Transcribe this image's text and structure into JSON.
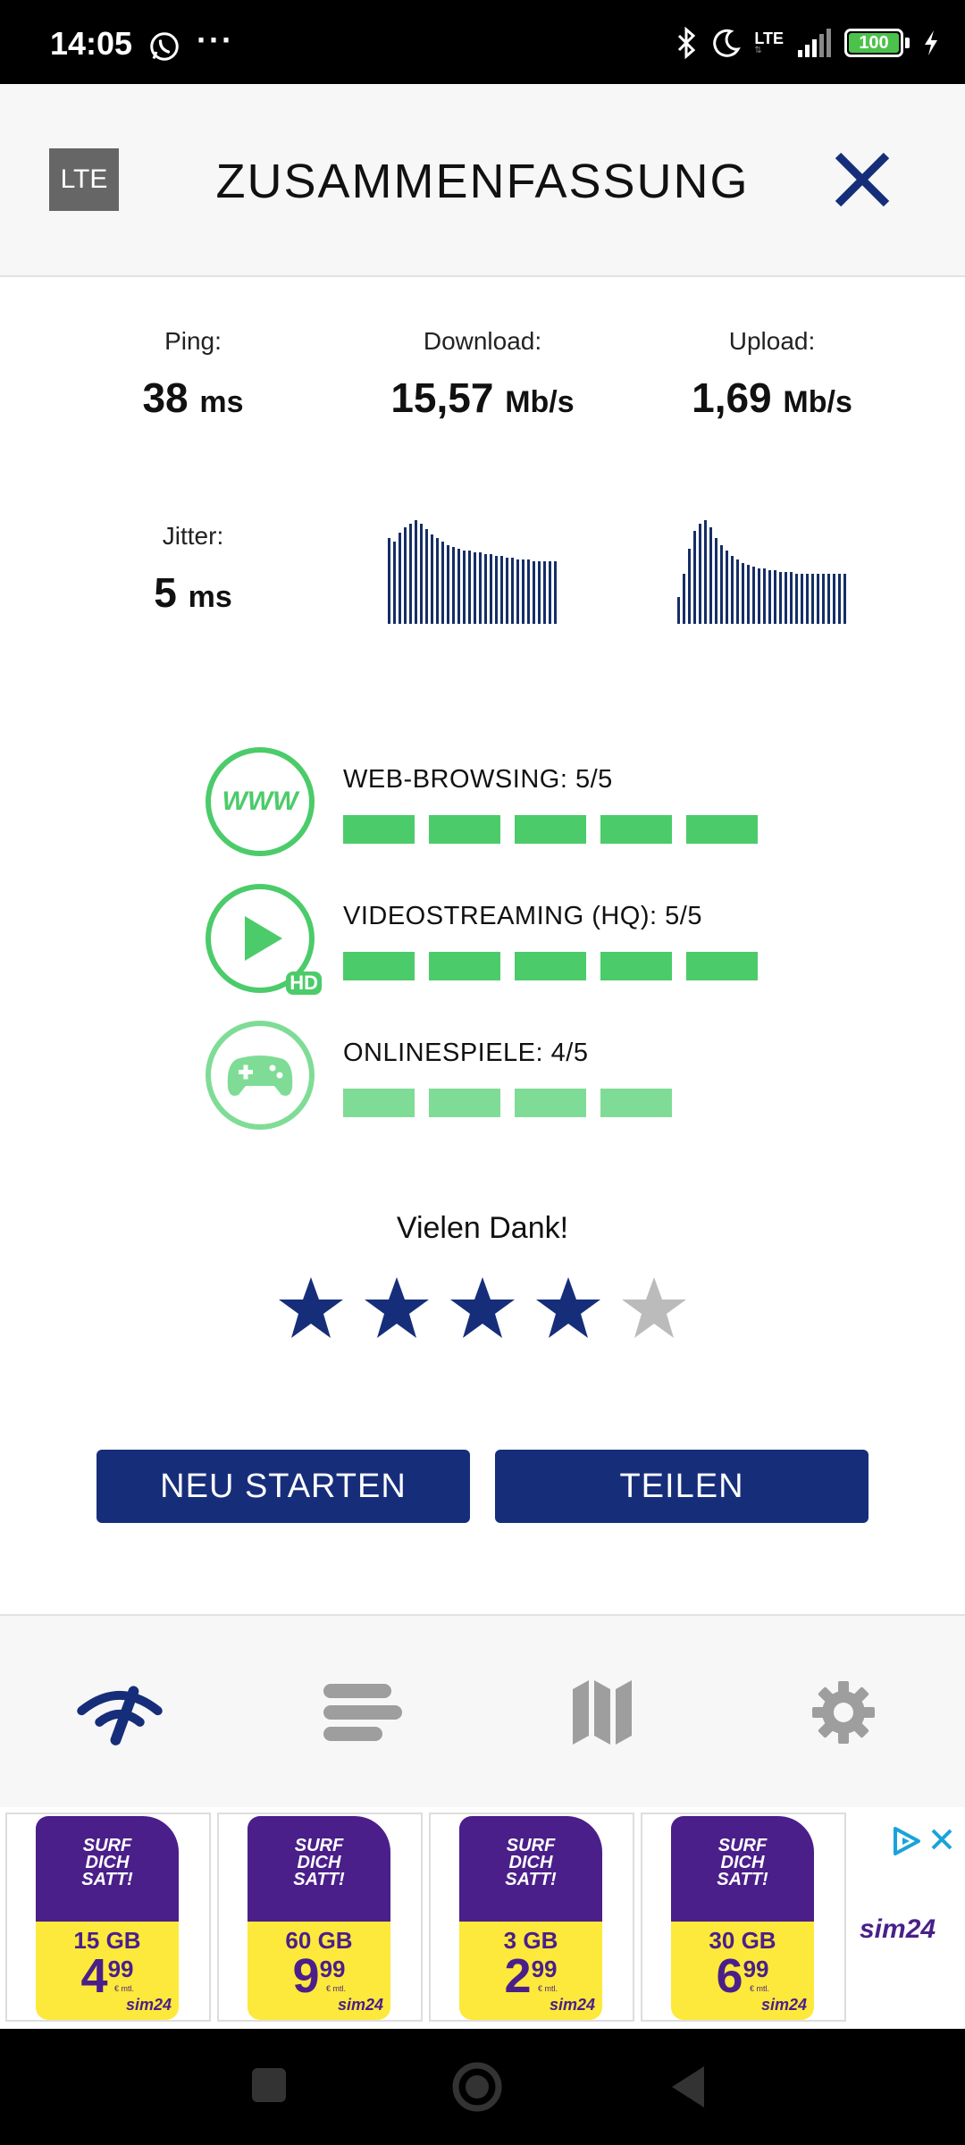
{
  "status_bar": {
    "time": "14:05",
    "more": "···",
    "network": "LTE",
    "battery": "100",
    "battery_level_percent": 100
  },
  "header": {
    "badge": "LTE",
    "title": "ZUSAMMENFASSUNG"
  },
  "metrics": {
    "ping": {
      "label": "Ping:",
      "value": "38",
      "unit": "ms"
    },
    "download": {
      "label": "Download:",
      "value": "15,57",
      "unit": "Mb/s"
    },
    "upload": {
      "label": "Upload:",
      "value": "1,69",
      "unit": "Mb/s"
    },
    "jitter": {
      "label": "Jitter:",
      "value": "5",
      "unit": "ms"
    }
  },
  "quality": [
    {
      "label": "WEB-BROWSING: 5/5",
      "score": 5,
      "icon": "www-icon",
      "icon_text": "WWW"
    },
    {
      "label": "VIDEOSTREAMING (HQ): 5/5",
      "score": 5,
      "icon": "play-hd-icon",
      "icon_text": "HD"
    },
    {
      "label": "ONLINESPIELE: 4/5",
      "score": 4,
      "icon": "gamepad-icon"
    }
  ],
  "rating": {
    "thanks": "Vielen Dank!",
    "stars_filled": 4,
    "stars_total": 5
  },
  "buttons": {
    "restart": "NEU STARTEN",
    "share": "TEILEN"
  },
  "bottom_nav": [
    "speedtest-icon",
    "history-icon",
    "map-icon",
    "settings-icon"
  ],
  "ad": {
    "headline": [
      "SURF",
      "DICH",
      "SATT!"
    ],
    "offers": [
      {
        "data": "15 GB",
        "price_main": "4",
        "price_cents": "99"
      },
      {
        "data": "60 GB",
        "price_main": "9",
        "price_cents": "99"
      },
      {
        "data": "3 GB",
        "price_main": "2",
        "price_cents": "99"
      },
      {
        "data": "30 GB",
        "price_main": "6",
        "price_cents": "99"
      }
    ],
    "per_month": "€ mtl.",
    "brand": "sim24"
  },
  "colors": {
    "accent": "#162e7a",
    "good": "#4ccb6a",
    "good_light": "#7fdc96",
    "star_off": "#bbbbbb"
  }
}
